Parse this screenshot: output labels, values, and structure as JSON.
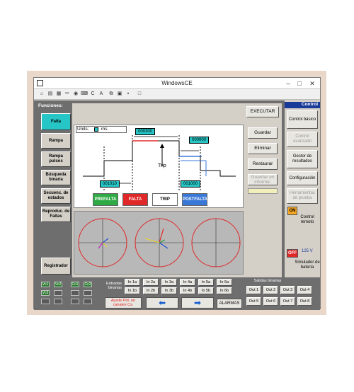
{
  "window": {
    "title": "WindowsCE"
  },
  "left_panel": {
    "header": "Funciones:",
    "items": [
      "Falta",
      "Rampa",
      "Rampa pulsos",
      "Búsqueda binaria",
      "Secuenc. de estados",
      "Reproduc. de Faltas"
    ],
    "bottom": "Registrador"
  },
  "center": {
    "execute": "EXECUTAR",
    "units_label": "Units:",
    "units_value": "ms",
    "values": {
      "v1": "000300",
      "v2": "000000",
      "v3": "001010",
      "v4": "001000"
    },
    "trip_label": "Trip",
    "states": [
      "PREFALTA",
      "FALTA",
      "TRIP",
      "POSTFALTA"
    ],
    "buttons": {
      "save": "Guardar",
      "delete": "Eliminar",
      "restore": "Restaurar",
      "save_report": "Guardar en informe:"
    }
  },
  "right_panel": {
    "header": "Control",
    "items": [
      "Control básico",
      "Control avanzado",
      "Gestor de resultados",
      "Configuración",
      "Herramientas de prueba"
    ],
    "on_label": "ON",
    "remote_label": "Control remoto",
    "off_label": "OFF",
    "voltage": "125 V",
    "battery_label": "Simulador de batería"
  },
  "bottom": {
    "sources": [
      "Vc1",
      "Vc2",
      "Cc1",
      "Cc2",
      "Vc3"
    ],
    "inputs_label": "Entradas binarias",
    "inputs_row1": [
      "In 1a",
      "In 2a",
      "In 3a",
      "In 4a",
      "In 5a",
      "In 6a"
    ],
    "inputs_row2": [
      "In 1b",
      "In 2b",
      "In 3b",
      "In 4b",
      "In 5b",
      "In 6b"
    ],
    "adjust_label": "Ajuste Pot. en canales Cs.",
    "alarms": "ALARMAS",
    "outputs_label": "Salidas binarias",
    "outputs_row1": [
      "Out 1",
      "Out 2",
      "Out 3",
      "Out 4"
    ],
    "outputs_row2": [
      "Out 5",
      "Out 6",
      "Out 7",
      "Out 8"
    ]
  },
  "colors": {
    "accent": "#26c6c6",
    "prefalta": "#2eaa44",
    "falta": "#e02828",
    "postfalta": "#3a78d8",
    "control_header": "#1a3a9a"
  }
}
